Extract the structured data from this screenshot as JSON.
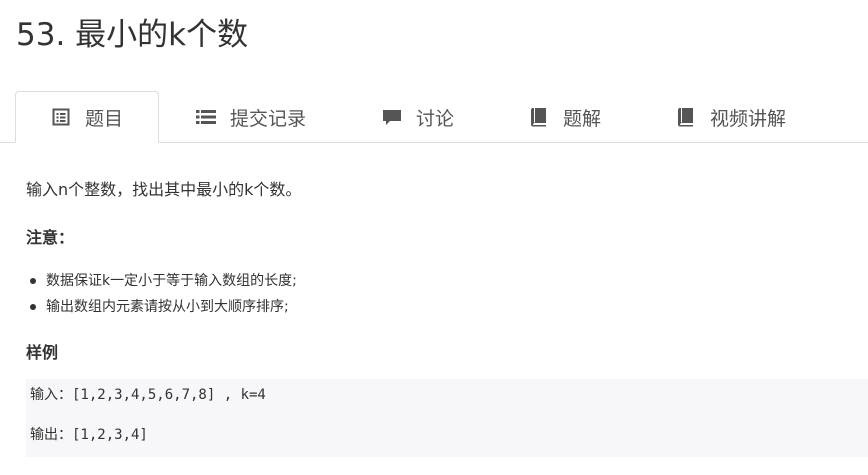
{
  "problem": {
    "title": "53. 最小的k个数"
  },
  "tabs": [
    {
      "label": "题目",
      "icon": "document-list-icon",
      "active": true
    },
    {
      "label": "提交记录",
      "icon": "list-icon",
      "active": false
    },
    {
      "label": "讨论",
      "icon": "comment-icon",
      "active": false
    },
    {
      "label": "题解",
      "icon": "book-icon",
      "active": false
    },
    {
      "label": "视频讲解",
      "icon": "book-icon",
      "active": false
    }
  ],
  "content": {
    "description": "输入n个整数，找出其中最小的k个数。",
    "note_heading": "注意：",
    "notes": [
      "数据保证k一定小于等于输入数组的长度;",
      "输出数组内元素请按从小到大顺序排序;"
    ],
    "sample_heading": "样例",
    "sample_input": "输入：[1,2,3,4,5,6,7,8] , k=4",
    "sample_output": "输出：[1,2,3,4]"
  },
  "colors": {
    "text": "#333333",
    "tab_text": "#555555",
    "border": "#dddddd",
    "code_bg": "#f7f7f9",
    "icon": "#555555"
  }
}
